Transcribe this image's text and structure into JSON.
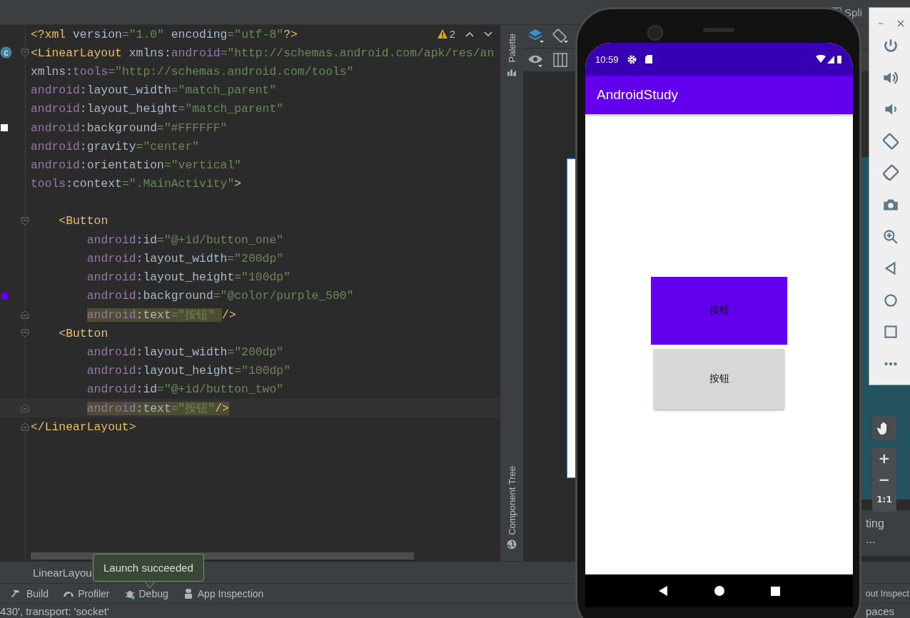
{
  "top_bar": {
    "split_label": "Spli"
  },
  "editor": {
    "warning_count": "2",
    "lines": [
      {
        "kind": "code",
        "current": false,
        "tokens": [
          {
            "kind": "tag",
            "text": "<?xml"
          },
          {
            "kind": "plain",
            "text": " version"
          },
          {
            "kind": "val",
            "text": "=\"1.0\""
          },
          {
            "kind": "plain",
            "text": " encoding"
          },
          {
            "kind": "val",
            "text": "=\"utf-8\""
          },
          {
            "kind": "tag",
            "text": "?>"
          }
        ]
      },
      {
        "kind": "code",
        "current": false,
        "fold": {
          "kind": "open"
        },
        "marker": {
          "kind": "class",
          "label": "c"
        },
        "tokens": [
          {
            "kind": "tag",
            "text": "<LinearLayout"
          },
          {
            "kind": "plain",
            "text": " xmlns:"
          },
          {
            "kind": "ns",
            "text": "android"
          },
          {
            "kind": "val",
            "text": "=\"http://schemas.android.com/apk/res/an"
          }
        ]
      },
      {
        "kind": "code",
        "current": false,
        "tokens": [
          {
            "kind": "plain",
            "text": "xmlns:"
          },
          {
            "kind": "ns",
            "text": "tools"
          },
          {
            "kind": "val",
            "text": "=\"http://schemas.android.com/tools\""
          }
        ]
      },
      {
        "kind": "code",
        "current": false,
        "tokens": [
          {
            "kind": "ns",
            "text": "android"
          },
          {
            "kind": "plain",
            "text": ":layout_width"
          },
          {
            "kind": "val",
            "text": "=\"match_parent\""
          }
        ]
      },
      {
        "kind": "code",
        "current": false,
        "tokens": [
          {
            "kind": "ns",
            "text": "android"
          },
          {
            "kind": "plain",
            "text": ":layout_height"
          },
          {
            "kind": "val",
            "text": "=\"match_parent\""
          }
        ]
      },
      {
        "kind": "code",
        "current": false,
        "marker": {
          "kind": "swatch",
          "color": "#ffffff"
        },
        "tokens": [
          {
            "kind": "ns",
            "text": "android"
          },
          {
            "kind": "plain",
            "text": ":background"
          },
          {
            "kind": "val",
            "text": "=\"#FFFFFF\""
          }
        ]
      },
      {
        "kind": "code",
        "current": false,
        "tokens": [
          {
            "kind": "ns",
            "text": "android"
          },
          {
            "kind": "plain",
            "text": ":gravity"
          },
          {
            "kind": "val",
            "text": "=\"center\""
          }
        ]
      },
      {
        "kind": "code",
        "current": false,
        "tokens": [
          {
            "kind": "ns",
            "text": "android"
          },
          {
            "kind": "plain",
            "text": ":orientation"
          },
          {
            "kind": "val",
            "text": "=\"vertical\""
          }
        ]
      },
      {
        "kind": "code",
        "current": false,
        "tokens": [
          {
            "kind": "ns",
            "text": "tools"
          },
          {
            "kind": "plain",
            "text": ":context"
          },
          {
            "kind": "val",
            "text": "=\".MainActivity\""
          },
          {
            "kind": "tag",
            "text": ">"
          }
        ]
      },
      {
        "kind": "blank",
        "current": false
      },
      {
        "kind": "code",
        "current": false,
        "fold": {
          "kind": "open"
        },
        "tokens": [
          {
            "kind": "tag",
            "text": "    <Button"
          }
        ]
      },
      {
        "kind": "code",
        "current": false,
        "tokens": [
          {
            "kind": "ns",
            "text": "        android"
          },
          {
            "kind": "plain",
            "text": ":id"
          },
          {
            "kind": "val",
            "text": "=\"@+id/button_one\""
          }
        ]
      },
      {
        "kind": "code",
        "current": false,
        "tokens": [
          {
            "kind": "ns",
            "text": "        android"
          },
          {
            "kind": "plain",
            "text": ":layout_width"
          },
          {
            "kind": "val",
            "text": "=\"200dp\""
          }
        ]
      },
      {
        "kind": "code",
        "current": false,
        "tokens": [
          {
            "kind": "ns",
            "text": "        android"
          },
          {
            "kind": "plain",
            "text": ":layout_height"
          },
          {
            "kind": "val",
            "text": "=\"100dp\""
          }
        ]
      },
      {
        "kind": "code",
        "current": false,
        "marker": {
          "kind": "swatch",
          "color": "#6200ee"
        },
        "tokens": [
          {
            "kind": "ns",
            "text": "        android"
          },
          {
            "kind": "plain",
            "text": ":background"
          },
          {
            "kind": "val",
            "text": "=\"@color/purple_500\""
          }
        ]
      },
      {
        "kind": "code",
        "current": false,
        "fold": {
          "kind": "close"
        },
        "tokens": [
          {
            "kind": "ns",
            "text": "        android",
            "highlight": true
          },
          {
            "kind": "plain",
            "text": ":text",
            "highlight": true
          },
          {
            "kind": "val",
            "text": "=\"按钮\" ",
            "highlight": true
          },
          {
            "kind": "tag",
            "text": "/>"
          }
        ]
      },
      {
        "kind": "code",
        "current": false,
        "fold": {
          "kind": "open"
        },
        "tokens": [
          {
            "kind": "tag",
            "text": "    <Button"
          }
        ]
      },
      {
        "kind": "code",
        "current": false,
        "tokens": [
          {
            "kind": "ns",
            "text": "        android"
          },
          {
            "kind": "plain",
            "text": ":layout_width"
          },
          {
            "kind": "val",
            "text": "=\"200dp\""
          }
        ]
      },
      {
        "kind": "code",
        "current": false,
        "tokens": [
          {
            "kind": "ns",
            "text": "        android"
          },
          {
            "kind": "plain",
            "text": ":layout_height"
          },
          {
            "kind": "val",
            "text": "=\"100dp\""
          }
        ]
      },
      {
        "kind": "code",
        "current": false,
        "tokens": [
          {
            "kind": "ns",
            "text": "        android"
          },
          {
            "kind": "plain",
            "text": ":id"
          },
          {
            "kind": "val",
            "text": "=\"@+id/button_two\""
          }
        ]
      },
      {
        "kind": "code",
        "current": true,
        "fold": {
          "kind": "close"
        },
        "tokens": [
          {
            "kind": "ns",
            "text": "        android",
            "highlight": true
          },
          {
            "kind": "plain",
            "text": ":text",
            "highlight": true
          },
          {
            "kind": "val",
            "text": "=\"按钮\"",
            "highlight": true
          },
          {
            "kind": "tag",
            "text": "/>",
            "highlight": true
          }
        ]
      },
      {
        "kind": "code",
        "current": false,
        "fold": {
          "kind": "close"
        },
        "tokens": [
          {
            "kind": "tag",
            "text": "</LinearLayout>"
          }
        ]
      }
    ]
  },
  "side_strip": {
    "palette": "Palette",
    "component_tree": "Component Tree"
  },
  "design": {
    "panel_text": "ting",
    "panel_more": "..."
  },
  "breadcrumb": "LinearLayou",
  "toast": "Launch succeeded",
  "tool_windows": [
    {
      "kind": "build",
      "label": "Build"
    },
    {
      "kind": "profiler",
      "label": "Profiler"
    },
    {
      "kind": "debug",
      "label": "Debug"
    },
    {
      "kind": "inspection",
      "label": "App Inspection"
    }
  ],
  "tool_windows_right": "out Inspect",
  "status_bar": {
    "message": "430', transport: 'socket'",
    "right": "paces"
  },
  "phone": {
    "time": "10:59",
    "app_title": "AndroidStudy",
    "buttons": [
      {
        "label": "按钮",
        "color": "#6200ee"
      },
      {
        "label": "按钮",
        "color": "#d6d7d7"
      }
    ]
  },
  "zoom_controls": [
    "+",
    "−",
    "1:1"
  ]
}
